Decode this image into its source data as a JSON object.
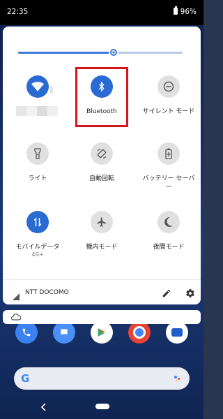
{
  "status_bar": {
    "time": "22:35",
    "battery": "96%"
  },
  "brightness": {
    "level": 0.58
  },
  "tiles": [
    {
      "label": "",
      "sublabel": "",
      "state": "on",
      "icon": "wifi-icon"
    },
    {
      "label": "Bluetooth",
      "sublabel": "",
      "state": "on",
      "icon": "bluetooth-icon"
    },
    {
      "label": "サイレント モード",
      "sublabel": "",
      "state": "off",
      "icon": "do-not-disturb-icon"
    },
    {
      "label": "ライト",
      "sublabel": "",
      "state": "off",
      "icon": "flashlight-icon"
    },
    {
      "label": "自動回転",
      "sublabel": "",
      "state": "off",
      "icon": "auto-rotate-icon"
    },
    {
      "label": "バッテリー セーバー",
      "sublabel": "",
      "state": "off",
      "icon": "battery-saver-icon"
    },
    {
      "label": "モバイルデータ",
      "sublabel": "4G+",
      "state": "on",
      "icon": "mobile-data-icon"
    },
    {
      "label": "機内モード",
      "sublabel": "",
      "state": "off",
      "icon": "airplane-icon"
    },
    {
      "label": "夜間モード",
      "sublabel": "",
      "state": "off",
      "icon": "night-mode-icon"
    }
  ],
  "carrier": {
    "name": "NTT DOCOMO"
  },
  "colors": {
    "accent": "#2a6bd3",
    "highlight": "#d8141d"
  }
}
